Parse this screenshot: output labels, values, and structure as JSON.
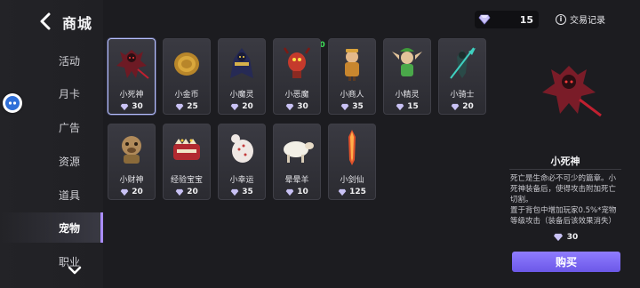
{
  "header": {
    "title": "商城"
  },
  "sidebar": {
    "items": [
      {
        "label": "活动"
      },
      {
        "label": "月卡"
      },
      {
        "label": "广告"
      },
      {
        "label": "资源"
      },
      {
        "label": "道具"
      },
      {
        "label": "宠物"
      },
      {
        "label": "职业"
      }
    ],
    "active": "宠物"
  },
  "currency": {
    "amount": "15",
    "icon": "gem-icon"
  },
  "records": {
    "label": "交易记录"
  },
  "fps_overlay": "FPS60",
  "pets": [
    {
      "name": "小死神",
      "price": "30"
    },
    {
      "name": "小金币",
      "price": "25"
    },
    {
      "name": "小魔灵",
      "price": "20"
    },
    {
      "name": "小恶魔",
      "price": "30"
    },
    {
      "name": "小商人",
      "price": "35"
    },
    {
      "name": "小精灵",
      "price": "15"
    },
    {
      "name": "小骑士",
      "price": "20"
    },
    {
      "name": "小财神",
      "price": "20"
    },
    {
      "name": "经验宝宝",
      "price": "20"
    },
    {
      "name": "小幸运",
      "price": "35"
    },
    {
      "name": "晕晕羊",
      "price": "10"
    },
    {
      "name": "小剑仙",
      "price": "125"
    }
  ],
  "detail": {
    "name": "小死神",
    "description": "死亡是生命必不可少的篇章。小死神装备后，使得攻击附加死亡切割。",
    "description2": "置于背包中增加玩家0.5%*宠物等级攻击（装备后该效果消失）",
    "price": "30",
    "buy_label": "购买"
  },
  "colors": {
    "accent": "#7b68f0",
    "background": "#1c1c20"
  }
}
